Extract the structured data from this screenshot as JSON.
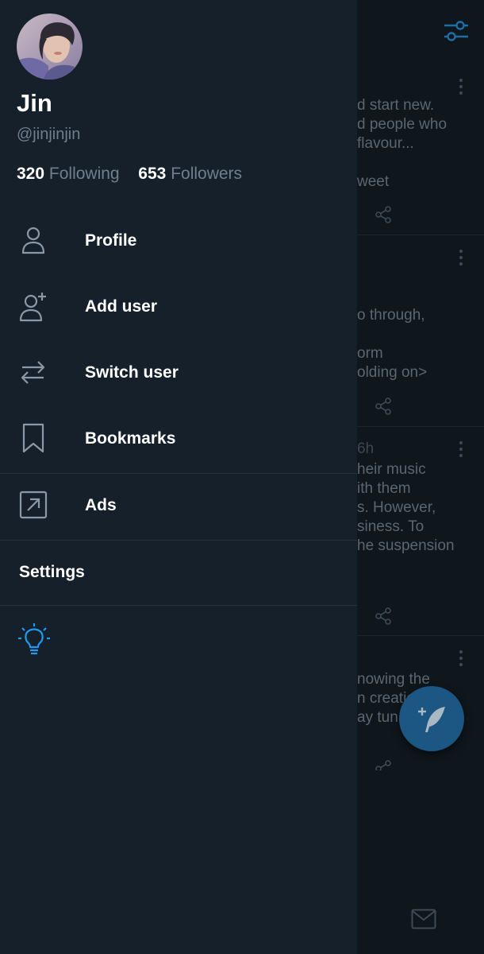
{
  "user": {
    "name": "Jin",
    "handle": "@jinjinjin",
    "following_count": "320",
    "following_label": "Following",
    "followers_count": "653",
    "followers_label": "Followers"
  },
  "menu": {
    "items": [
      {
        "label": "Profile",
        "icon": "person-icon"
      },
      {
        "label": "Add user",
        "icon": "add-user-icon"
      },
      {
        "label": "Switch user",
        "icon": "switch-arrows-icon"
      },
      {
        "label": "Bookmarks",
        "icon": "bookmark-icon"
      },
      {
        "label": "Ads",
        "icon": "external-arrow-icon"
      }
    ],
    "settings_label": "Settings",
    "theme_toggle_icon": "lightbulb-icon"
  },
  "timeline": {
    "tweets": [
      {
        "lines": [
          "d start new.",
          "d people who",
          "flavour...",
          "weet"
        ]
      },
      {
        "lines": [
          "o through,",
          "orm",
          "olding on>"
        ]
      },
      {
        "lines": [
          "6h",
          "heir music",
          "ith them",
          "s. However,",
          "siness. To",
          "he suspension"
        ]
      },
      {
        "lines": [
          "nowing the",
          "n creatio",
          "ay tun"
        ]
      }
    ],
    "compose_icon": "compose-feather-icon",
    "messages_icon": "mail-icon",
    "filter_icon": "sliders-icon"
  },
  "colors": {
    "drawer_bg": "#15202b",
    "accent": "#1d9bf0",
    "muted_text": "#6e7f8e"
  }
}
